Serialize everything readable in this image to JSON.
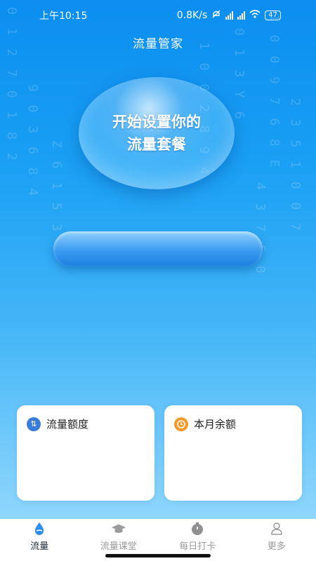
{
  "status_bar": {
    "time": "上午10:15",
    "network_speed": "0.8K/s",
    "battery": "47",
    "icons": [
      "mute-icon",
      "signal-hd-1-icon",
      "signal-hd-2-icon",
      "wifi-icon",
      "battery-icon"
    ]
  },
  "header": {
    "title": "流量管家"
  },
  "bubble": {
    "label": "开始设置你的\n流量套餐"
  },
  "cards": [
    {
      "label": "流量额度",
      "icon": "data-quota-icon",
      "icon_color": "#3a7bdc"
    },
    {
      "label": "本月余额",
      "icon": "clock-icon",
      "icon_color": "#f39a2a"
    }
  ],
  "nav": {
    "items": [
      {
        "label": "流量",
        "icon": "data-drop-icon",
        "active": true
      },
      {
        "label": "流量课堂",
        "icon": "graduation-cap-icon",
        "active": false
      },
      {
        "label": "每日打卡",
        "icon": "check-in-icon",
        "active": false
      },
      {
        "label": "更多",
        "icon": "user-icon",
        "active": false
      }
    ]
  },
  "colors": {
    "background_top": "#0b8ef0",
    "background_bottom": "#9fdcfc",
    "accent": "#1c7fe0"
  }
}
